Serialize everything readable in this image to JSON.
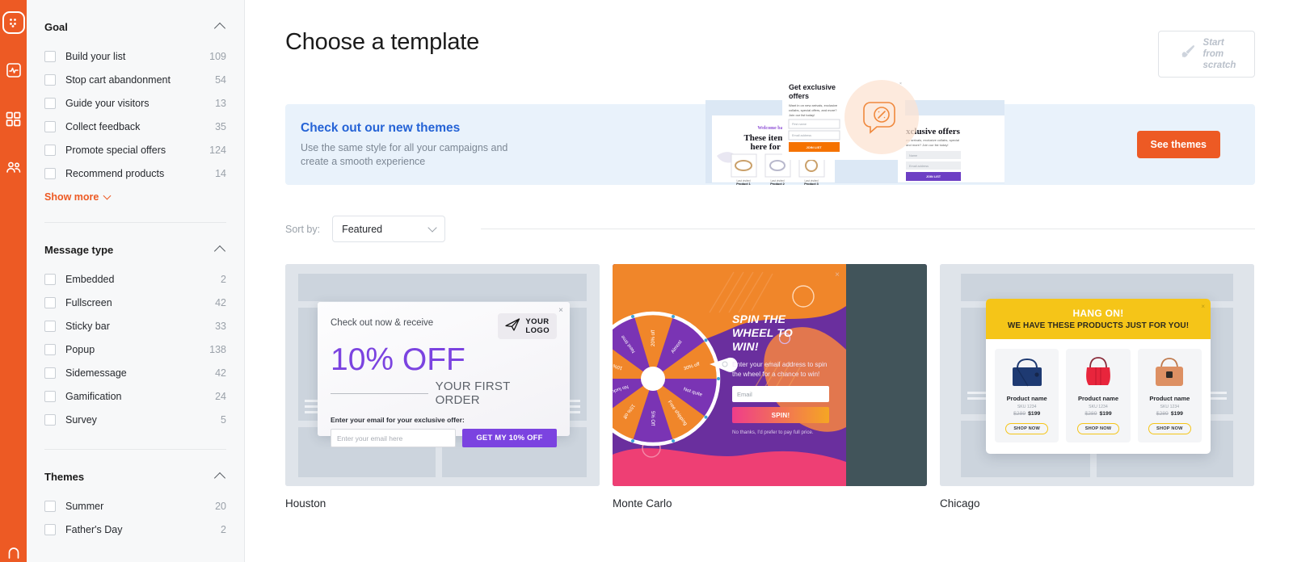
{
  "rail": {
    "items": [
      {
        "name": "campaigns-icon",
        "active": true
      },
      {
        "name": "analytics-icon",
        "active": false
      },
      {
        "name": "dashboard-icon",
        "active": false
      },
      {
        "name": "audience-icon",
        "active": false
      }
    ],
    "bottom": {
      "name": "notifications-icon"
    },
    "brand_color": "#ed5a24"
  },
  "sidebar": {
    "facets": [
      {
        "title": "Goal",
        "collapse_icon": "chevron-up-icon",
        "rows": [
          {
            "label": "Build your list",
            "count": "109"
          },
          {
            "label": "Stop cart abandonment",
            "count": "54"
          },
          {
            "label": "Guide your visitors",
            "count": "13"
          },
          {
            "label": "Collect feedback",
            "count": "35"
          },
          {
            "label": "Promote special offers",
            "count": "124"
          },
          {
            "label": "Recommend products",
            "count": "14"
          }
        ],
        "show_more": "Show more"
      },
      {
        "title": "Message type",
        "collapse_icon": "chevron-up-icon",
        "rows": [
          {
            "label": "Embedded",
            "count": "2"
          },
          {
            "label": "Fullscreen",
            "count": "42"
          },
          {
            "label": "Sticky bar",
            "count": "33"
          },
          {
            "label": "Popup",
            "count": "138"
          },
          {
            "label": "Sidemessage",
            "count": "42"
          },
          {
            "label": "Gamification",
            "count": "24"
          },
          {
            "label": "Survey",
            "count": "5"
          }
        ]
      },
      {
        "title": "Themes",
        "collapse_icon": "chevron-up-icon",
        "rows": [
          {
            "label": "Summer",
            "count": "20"
          },
          {
            "label": "Father's Day",
            "count": "2"
          }
        ]
      }
    ]
  },
  "header": {
    "title": "Choose a template",
    "scratch_button": {
      "line1": "Start",
      "line2": "from",
      "line3": "scratch",
      "icon": "paintbrush-icon"
    }
  },
  "banner": {
    "title": "Check out our new themes",
    "subtitle_line1": "Use the same style for all your campaigns and",
    "subtitle_line2": "create a smooth experience",
    "cta": "See themes",
    "background": "#e9f2fb",
    "cta_color": "#ed5a24",
    "art": {
      "popup_center": {
        "title_line1": "Get exclusive",
        "title_line2": "offers",
        "body": "Want in on new arrivals, exclusive collabs, special offers, and more? Join our list today!",
        "field1": "First name",
        "field2": "Email address",
        "button": "JOIN LIST"
      },
      "popup_left": {
        "kicker": "Welcome back!",
        "title_line1": "These items are",
        "title_line2": "here for you",
        "products": [
          "Product 1",
          "Product 2",
          "Product 3"
        ],
        "product_kicker": "Last visited"
      },
      "popup_right": {
        "title": "xclusive offers",
        "body": "ew arrivals, exclusive collabs, special and more? Join our list today!",
        "field1": "Name",
        "field2": "Email address",
        "button": "JOIN LIST"
      }
    }
  },
  "sort": {
    "label": "Sort by:",
    "value": "Featured",
    "icon": "chevron-down-icon"
  },
  "templates": [
    {
      "name": "Houston",
      "preview": {
        "kind": "houston",
        "kicker": "Check out now & receive",
        "logo_line1": "YOUR",
        "logo_line2": "LOGO",
        "logo_icon": "paper-plane-icon",
        "headline": "10% OFF",
        "subhead": "YOUR FIRST ORDER",
        "form_label": "Enter your email for your exclusive offer:",
        "input_placeholder": "Enter your email here",
        "button": "GET MY 10% OFF",
        "accent": "#7b43e0",
        "close_icon": "close-icon"
      }
    },
    {
      "name": "Monte Carlo",
      "preview": {
        "kind": "montecarlo",
        "headline_line1": "SPIN THE",
        "headline_line2": "WHEEL TO",
        "headline_line3": "WIN!",
        "body": "Enter your email address to spin the wheel for a chance to win!",
        "input_placeholder": "Email",
        "button": "SPIN!",
        "decline": "No thanks, I'd prefer to pay full price.",
        "wheel_segments": [
          "20% off",
          "Almost",
          "30% off",
          "Not quite",
          "Free shipping",
          "5% Off",
          "15% off",
          "No luck today",
          "10% off",
          "Next time"
        ],
        "bg": "#6a2f9e",
        "accent": "#f5861f",
        "close_icon": "close-icon"
      }
    },
    {
      "name": "Chicago",
      "preview": {
        "kind": "chicago",
        "headline": "HANG ON!",
        "subhead": "WE HAVE THESE PRODUCTS JUST FOR YOU!",
        "products": [
          {
            "name": "Product name",
            "sku": "SKU 1234",
            "old_price": "$289",
            "price": "$199",
            "button": "SHOP NOW",
            "color": "#1e3a72"
          },
          {
            "name": "Product name",
            "sku": "SKU 1234",
            "old_price": "$289",
            "price": "$199",
            "button": "SHOP NOW",
            "color": "#e8253c"
          },
          {
            "name": "Product name",
            "sku": "SKU 1234",
            "old_price": "$289",
            "price": "$199",
            "button": "SHOP NOW",
            "color": "#dd9063"
          }
        ],
        "accent": "#f5c518",
        "close_icon": "close-icon"
      }
    }
  ]
}
